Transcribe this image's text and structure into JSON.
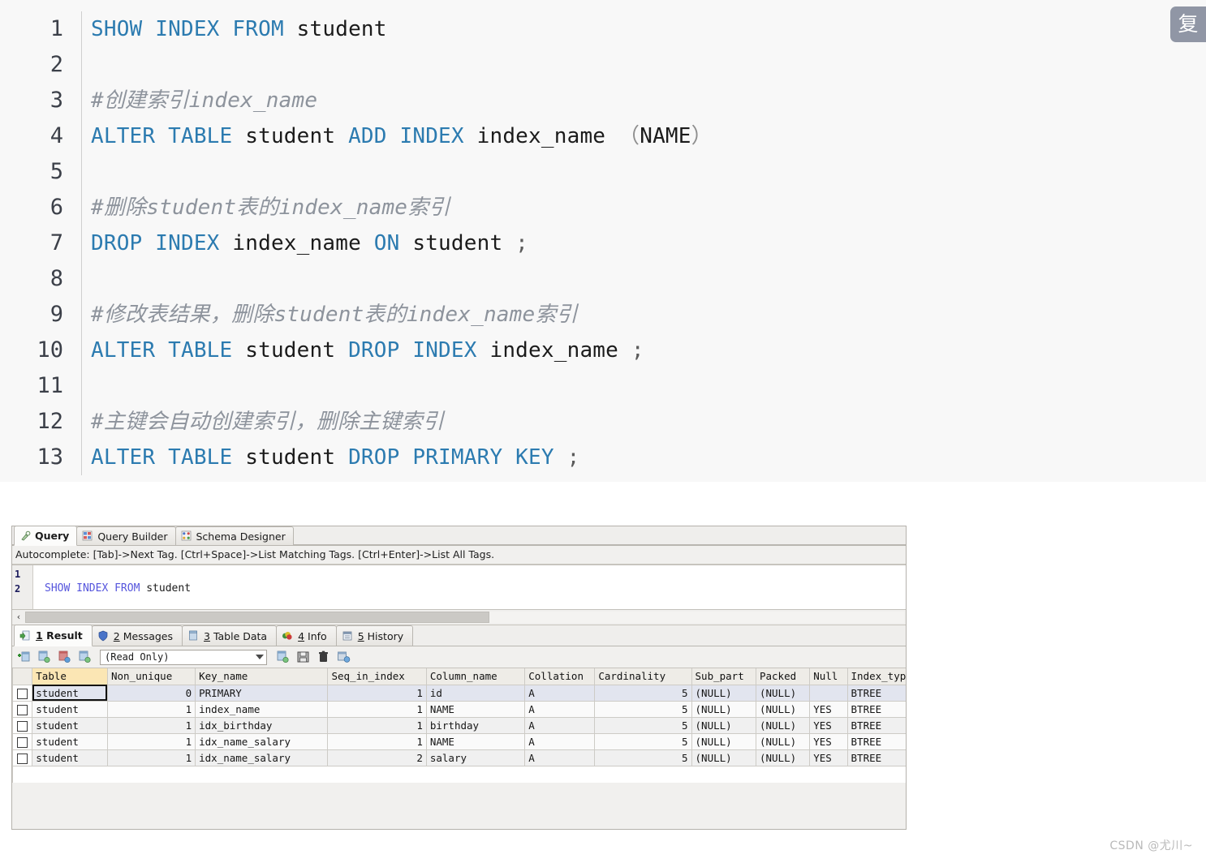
{
  "code_block": {
    "copy_button_label": "复制",
    "lines": [
      {
        "n": "1",
        "tokens": [
          {
            "t": "kw",
            "v": "SHOW INDEX FROM "
          },
          {
            "t": "id",
            "v": "student"
          }
        ]
      },
      {
        "n": "2",
        "tokens": []
      },
      {
        "n": "3",
        "tokens": [
          {
            "t": "cm",
            "v": "#创建索引index_name"
          }
        ]
      },
      {
        "n": "4",
        "tokens": [
          {
            "t": "kw",
            "v": "ALTER TABLE "
          },
          {
            "t": "id",
            "v": "student "
          },
          {
            "t": "kw",
            "v": "ADD INDEX "
          },
          {
            "t": "id",
            "v": "index_name "
          },
          {
            "t": "pn",
            "v": "（"
          },
          {
            "t": "id",
            "v": "NAME"
          },
          {
            "t": "pn",
            "v": "）"
          }
        ]
      },
      {
        "n": "5",
        "tokens": []
      },
      {
        "n": "6",
        "tokens": [
          {
            "t": "cm",
            "v": "#删除student表的index_name索引"
          }
        ]
      },
      {
        "n": "7",
        "tokens": [
          {
            "t": "kw",
            "v": "DROP INDEX "
          },
          {
            "t": "id",
            "v": "index_name "
          },
          {
            "t": "kw",
            "v": "ON "
          },
          {
            "t": "id",
            "v": "student "
          },
          {
            "t": "sc",
            "v": ";"
          }
        ]
      },
      {
        "n": "8",
        "tokens": []
      },
      {
        "n": "9",
        "tokens": [
          {
            "t": "cm",
            "v": "#修改表结果，删除student表的index_name索引"
          }
        ]
      },
      {
        "n": "10",
        "tokens": [
          {
            "t": "kw",
            "v": "ALTER TABLE "
          },
          {
            "t": "id",
            "v": "student "
          },
          {
            "t": "kw",
            "v": "DROP INDEX "
          },
          {
            "t": "id",
            "v": "index_name "
          },
          {
            "t": "sc",
            "v": ";"
          }
        ]
      },
      {
        "n": "11",
        "tokens": []
      },
      {
        "n": "12",
        "tokens": [
          {
            "t": "cm",
            "v": "#主键会自动创建索引，删除主键索引"
          }
        ]
      },
      {
        "n": "13",
        "tokens": [
          {
            "t": "kw",
            "v": "ALTER TABLE "
          },
          {
            "t": "id",
            "v": "student "
          },
          {
            "t": "kw",
            "v": "DROP PRIMARY KEY "
          },
          {
            "t": "sc",
            "v": ";"
          }
        ]
      }
    ]
  },
  "client": {
    "top_tabs": [
      {
        "label": "Query",
        "icon": "query-icon",
        "active": true
      },
      {
        "label": "Query Builder",
        "icon": "query-builder-icon",
        "active": false
      },
      {
        "label": "Schema Designer",
        "icon": "schema-designer-icon",
        "active": false
      }
    ],
    "hint_text": "Autocomplete: [Tab]->Next Tag. [Ctrl+Space]->List Matching Tags. [Ctrl+Enter]->List All Tags.",
    "editor": {
      "line_numbers": [
        "1",
        "2"
      ],
      "lines": [
        {
          "tokens": []
        },
        {
          "tokens": [
            {
              "t": "kw",
              "v": "SHOW INDEX FROM "
            },
            {
              "t": "id",
              "v": "student"
            }
          ]
        }
      ]
    },
    "hscroll": {
      "left_arrow": "‹"
    },
    "result_tabs": [
      {
        "num": "1",
        "label": "Result",
        "icon": "result-icon",
        "active": true
      },
      {
        "num": "2",
        "label": "Messages",
        "icon": "messages-icon",
        "active": false
      },
      {
        "num": "3",
        "label": "Table Data",
        "icon": "table-data-icon",
        "active": false
      },
      {
        "num": "4",
        "label": "Info",
        "icon": "info-icon",
        "active": false
      },
      {
        "num": "5",
        "label": "History",
        "icon": "history-icon",
        "active": false
      }
    ],
    "result_toolbar": {
      "mode_value": "(Read Only)",
      "buttons_left": [
        "insert-record-icon",
        "duplicate-record-icon",
        "edit-record-icon",
        "refresh-record-icon"
      ],
      "buttons_right": [
        "post-edit-icon",
        "save-icon",
        "delete-icon",
        "cancel-edit-icon"
      ]
    },
    "grid": {
      "columns": [
        "Table",
        "Non_unique",
        "Key_name",
        "Seq_in_index",
        "Column_name",
        "Collation",
        "Cardinality",
        "Sub_part",
        "Packed",
        "Null",
        "Index_type"
      ],
      "selected_column": "Table",
      "rows": [
        {
          "Table": "student",
          "Non_unique": "0",
          "Key_name": "PRIMARY",
          "Seq_in_index": "1",
          "Column_name": "id",
          "Collation": "A",
          "Cardinality": "5",
          "Sub_part": "(NULL)",
          "Packed": "(NULL)",
          "Null": "",
          "Index_type": "BTREE"
        },
        {
          "Table": "student",
          "Non_unique": "1",
          "Key_name": "index_name",
          "Seq_in_index": "1",
          "Column_name": "NAME",
          "Collation": "A",
          "Cardinality": "5",
          "Sub_part": "(NULL)",
          "Packed": "(NULL)",
          "Null": "YES",
          "Index_type": "BTREE"
        },
        {
          "Table": "student",
          "Non_unique": "1",
          "Key_name": "idx_birthday",
          "Seq_in_index": "1",
          "Column_name": "birthday",
          "Collation": "A",
          "Cardinality": "5",
          "Sub_part": "(NULL)",
          "Packed": "(NULL)",
          "Null": "YES",
          "Index_type": "BTREE"
        },
        {
          "Table": "student",
          "Non_unique": "1",
          "Key_name": "idx_name_salary",
          "Seq_in_index": "1",
          "Column_name": "NAME",
          "Collation": "A",
          "Cardinality": "5",
          "Sub_part": "(NULL)",
          "Packed": "(NULL)",
          "Null": "YES",
          "Index_type": "BTREE"
        },
        {
          "Table": "student",
          "Non_unique": "1",
          "Key_name": "idx_name_salary",
          "Seq_in_index": "2",
          "Column_name": "salary",
          "Collation": "A",
          "Cardinality": "5",
          "Sub_part": "(NULL)",
          "Packed": "(NULL)",
          "Null": "YES",
          "Index_type": "BTREE"
        }
      ]
    }
  },
  "watermark": "CSDN @尤川~",
  "colors": {
    "keyword_blue": "#2c7bb0",
    "comment_gray": "#8d939c",
    "code_bg": "#f8f8f8",
    "copy_btn_bg": "#9096a5",
    "selected_header": "#fbe6b4",
    "selected_row": "#e2e5ef"
  }
}
